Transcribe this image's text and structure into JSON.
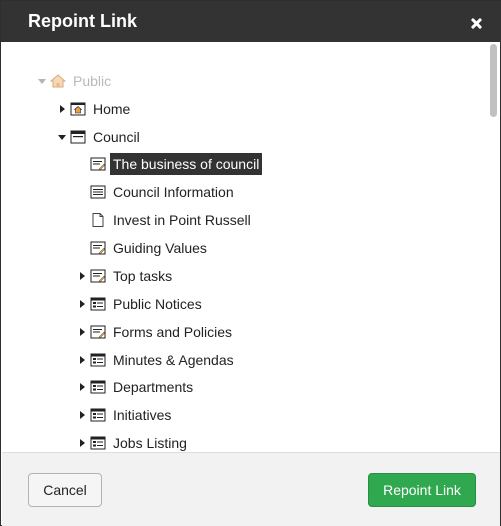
{
  "dialog": {
    "title": "Repoint Link"
  },
  "tree": {
    "root": {
      "label": "Public",
      "icon": "house-icon"
    },
    "items": [
      {
        "label": "Home",
        "icon": "house-page-icon"
      },
      {
        "label": "Council",
        "icon": "section-page-icon"
      },
      {
        "label": "The business of council",
        "icon": "document-pencil-icon",
        "selected": true
      },
      {
        "label": "Council Information",
        "icon": "document-lines-icon"
      },
      {
        "label": "Invest in Point Russell",
        "icon": "blank-page-icon"
      },
      {
        "label": "Guiding Values",
        "icon": "document-pencil-icon"
      },
      {
        "label": "Top tasks",
        "icon": "document-pencil-icon"
      },
      {
        "label": "Public Notices",
        "icon": "list-page-icon"
      },
      {
        "label": "Forms and Policies",
        "icon": "document-pencil-icon"
      },
      {
        "label": "Minutes & Agendas",
        "icon": "list-page-icon"
      },
      {
        "label": "Departments",
        "icon": "list-page-icon"
      },
      {
        "label": "Initiatives",
        "icon": "list-page-icon"
      },
      {
        "label": "Jobs Listing",
        "icon": "list-page-icon"
      }
    ]
  },
  "footer": {
    "cancel_label": "Cancel",
    "repoint_label": "Repoint Link"
  },
  "colors": {
    "titlebar": "#333333",
    "primary_button": "#2fa84f",
    "selected_bg": "#333333"
  }
}
